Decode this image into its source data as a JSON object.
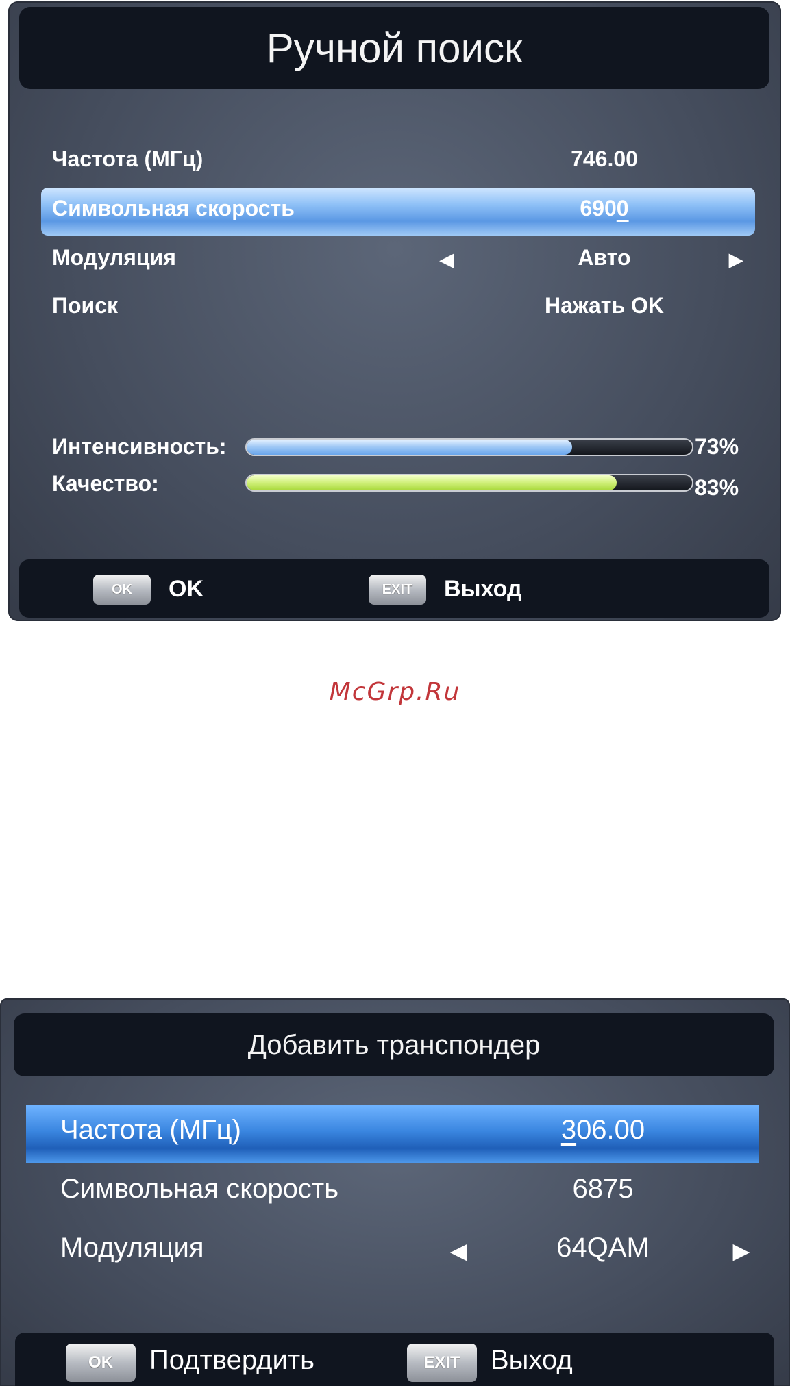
{
  "screen1": {
    "title": "Ручной поиск",
    "rows": [
      {
        "label": "Частота (МГц)",
        "value": "746.00"
      },
      {
        "label": "Символьная скорость",
        "value_main": "690",
        "value_cursor": "0",
        "selected": true
      },
      {
        "label": "Модуляция",
        "value": "Авто",
        "arrow_left": "◀",
        "arrow_right": "▶"
      },
      {
        "label": "Поиск",
        "value": "Нажать OK"
      }
    ],
    "signal": {
      "intensity_label": "Интенсивность:",
      "intensity_value": "73%",
      "intensity_level": 0.73,
      "quality_label": "Качество:",
      "quality_value": "83%",
      "quality_level": 0.83
    },
    "footer": {
      "ok_key": "OK",
      "ok_label": "OK",
      "exit_key": "EXIT",
      "exit_label": "Выход"
    }
  },
  "watermark": "McGrp.Ru",
  "screen2": {
    "title": "Добавить транспондер",
    "rows": [
      {
        "label": "Частота (МГц)",
        "value_cursor": "3",
        "value_rest": "06.00",
        "selected": true
      },
      {
        "label": "Символьная скорость",
        "value": "6875"
      },
      {
        "label": "Модуляция",
        "value": "64QAM",
        "arrow_left": "◀",
        "arrow_right": "▶"
      }
    ],
    "footer": {
      "ok_key": "OK",
      "ok_label": "Подтвердить",
      "exit_key": "EXIT",
      "exit_label": "Выход"
    }
  },
  "colors": {
    "highlight_top": "#8fc1f7",
    "highlight_bottom": "#1f5fb8",
    "intensity_bar": "#9cc6f5",
    "quality_bar": "#d0f07a",
    "watermark": "#c2363a"
  }
}
